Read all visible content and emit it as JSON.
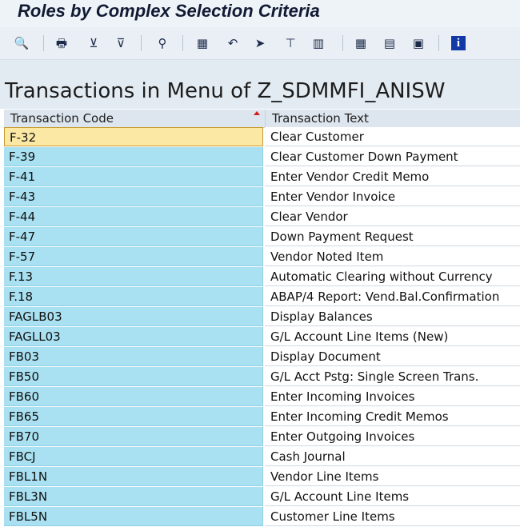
{
  "window": {
    "title": "Roles by Complex Selection Criteria"
  },
  "toolbar": {
    "buttons": [
      {
        "name": "details-icon",
        "glyph": "🔍"
      },
      {
        "name": "print-icon",
        "glyph": "🖶"
      },
      {
        "name": "set-filter-icon",
        "glyph": "⊻"
      },
      {
        "name": "filter-icon",
        "glyph": "⊽"
      },
      {
        "name": "find-icon",
        "glyph": "⚲"
      },
      {
        "name": "export-icon",
        "glyph": "▦"
      },
      {
        "name": "graphic-icon",
        "glyph": "↶"
      },
      {
        "name": "save-layout-icon",
        "glyph": "➤"
      },
      {
        "name": "choose-layout-icon",
        "glyph": "⊤"
      },
      {
        "name": "change-layout-icon",
        "glyph": "▥"
      },
      {
        "name": "grid-icon",
        "glyph": "▦"
      },
      {
        "name": "column-icon",
        "glyph": "▤"
      },
      {
        "name": "tree-icon",
        "glyph": "▣"
      },
      {
        "name": "info-icon",
        "glyph": "i"
      }
    ]
  },
  "heading": "Transactions in Menu of Z_SDMMFI_ANISW",
  "table": {
    "columns": [
      "Transaction Code",
      "Transaction Text"
    ],
    "rows": [
      {
        "code": "F-32",
        "text": "Clear Customer"
      },
      {
        "code": "F-39",
        "text": "Clear Customer Down Payment"
      },
      {
        "code": "F-41",
        "text": "Enter Vendor Credit Memo"
      },
      {
        "code": "F-43",
        "text": "Enter Vendor Invoice"
      },
      {
        "code": "F-44",
        "text": "Clear Vendor"
      },
      {
        "code": "F-47",
        "text": "Down Payment Request"
      },
      {
        "code": "F-57",
        "text": "Vendor Noted Item"
      },
      {
        "code": "F.13",
        "text": "Automatic Clearing without Currency"
      },
      {
        "code": "F.18",
        "text": "ABAP/4 Report: Vend.Bal.Confirmation"
      },
      {
        "code": "FAGLB03",
        "text": "Display Balances"
      },
      {
        "code": "FAGLL03",
        "text": "G/L Account Line Items (New)"
      },
      {
        "code": "FB03",
        "text": "Display Document"
      },
      {
        "code": "FB50",
        "text": "G/L Acct Pstg: Single Screen Trans."
      },
      {
        "code": "FB60",
        "text": "Enter Incoming Invoices"
      },
      {
        "code": "FB65",
        "text": "Enter Incoming Credit Memos"
      },
      {
        "code": "FB70",
        "text": "Enter Outgoing Invoices"
      },
      {
        "code": "FBCJ",
        "text": "Cash Journal"
      },
      {
        "code": "FBL1N",
        "text": "Vendor Line Items"
      },
      {
        "code": "FBL3N",
        "text": "G/L Account Line Items"
      },
      {
        "code": "FBL5N",
        "text": "Customer Line Items"
      }
    ]
  }
}
